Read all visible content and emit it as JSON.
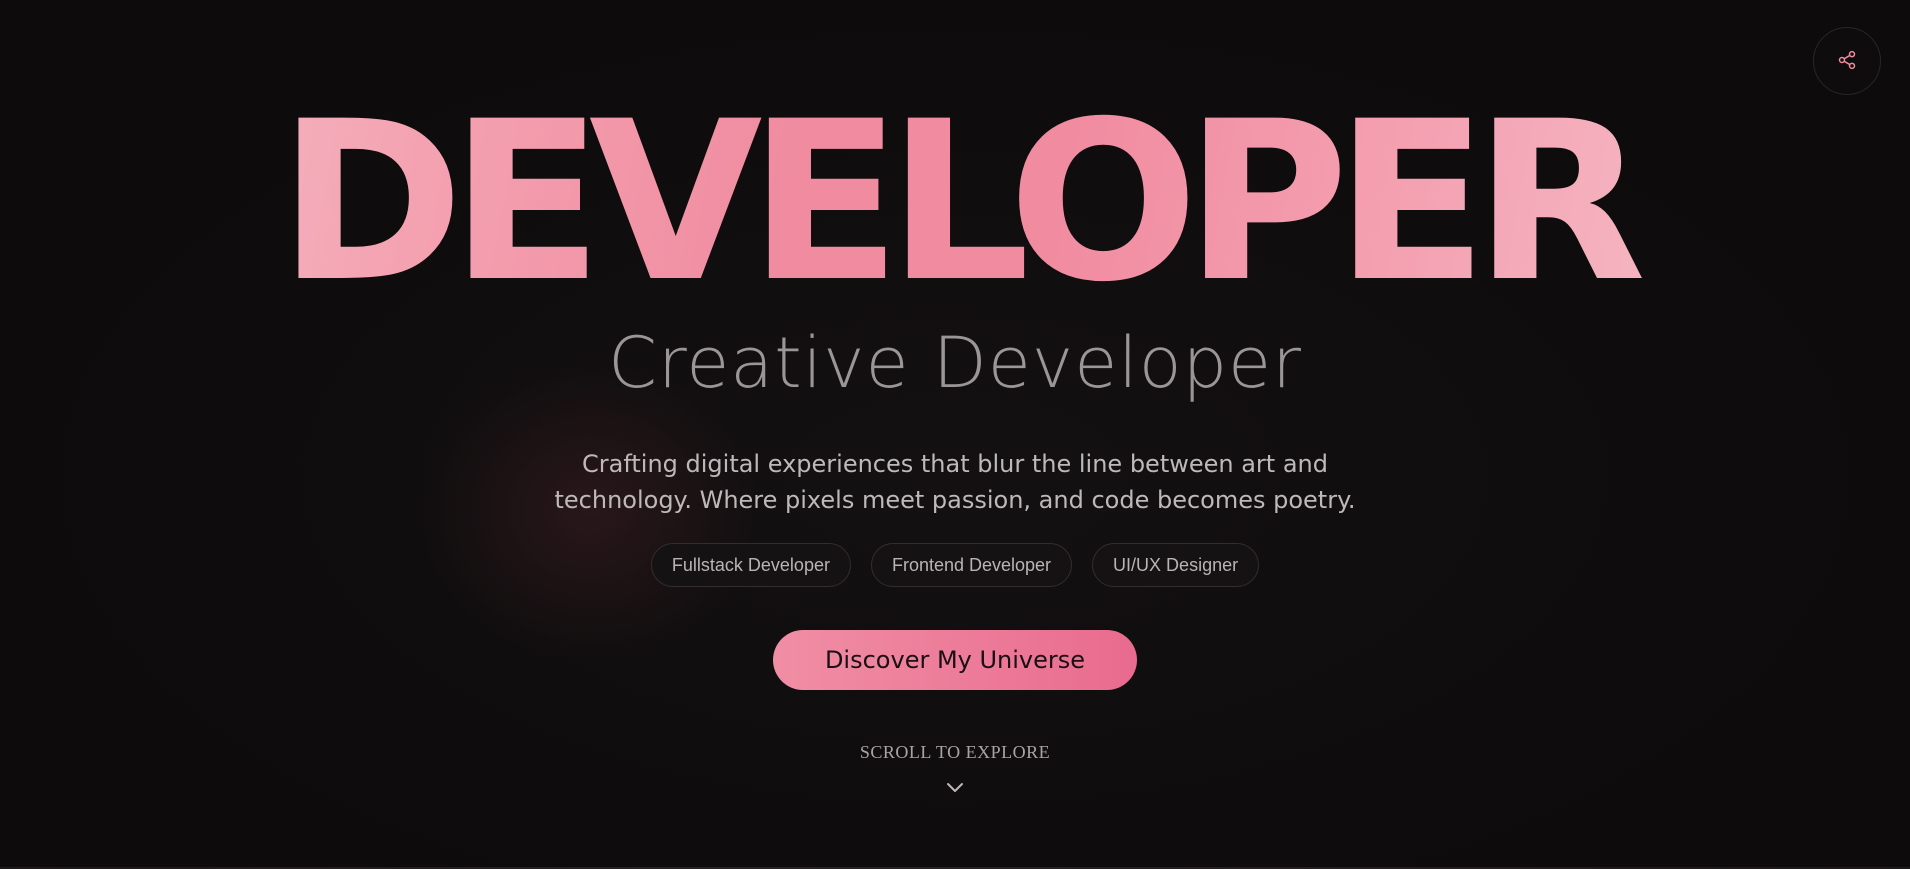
{
  "hero": {
    "title": "DEVELOPER",
    "subtitle": "Creative Developer",
    "description_line1": "Crafting digital experiences that blur the line between art and",
    "description_line2": "technology. Where pixels meet passion, and code becomes poetry.",
    "tags": [
      "Fullstack Developer",
      "Frontend Developer",
      "UI/UX Designer"
    ],
    "cta_label": "Discover My Universe",
    "scroll_label": "SCROLL TO EXPLORE"
  },
  "icons": {
    "share": "share-icon",
    "scroll": "chevron-down-icon"
  },
  "colors": {
    "background": "#0d0b0c",
    "accent": "#f08ba0",
    "accent_deep": "#e96b8f",
    "title_light": "#f5c8cf"
  }
}
